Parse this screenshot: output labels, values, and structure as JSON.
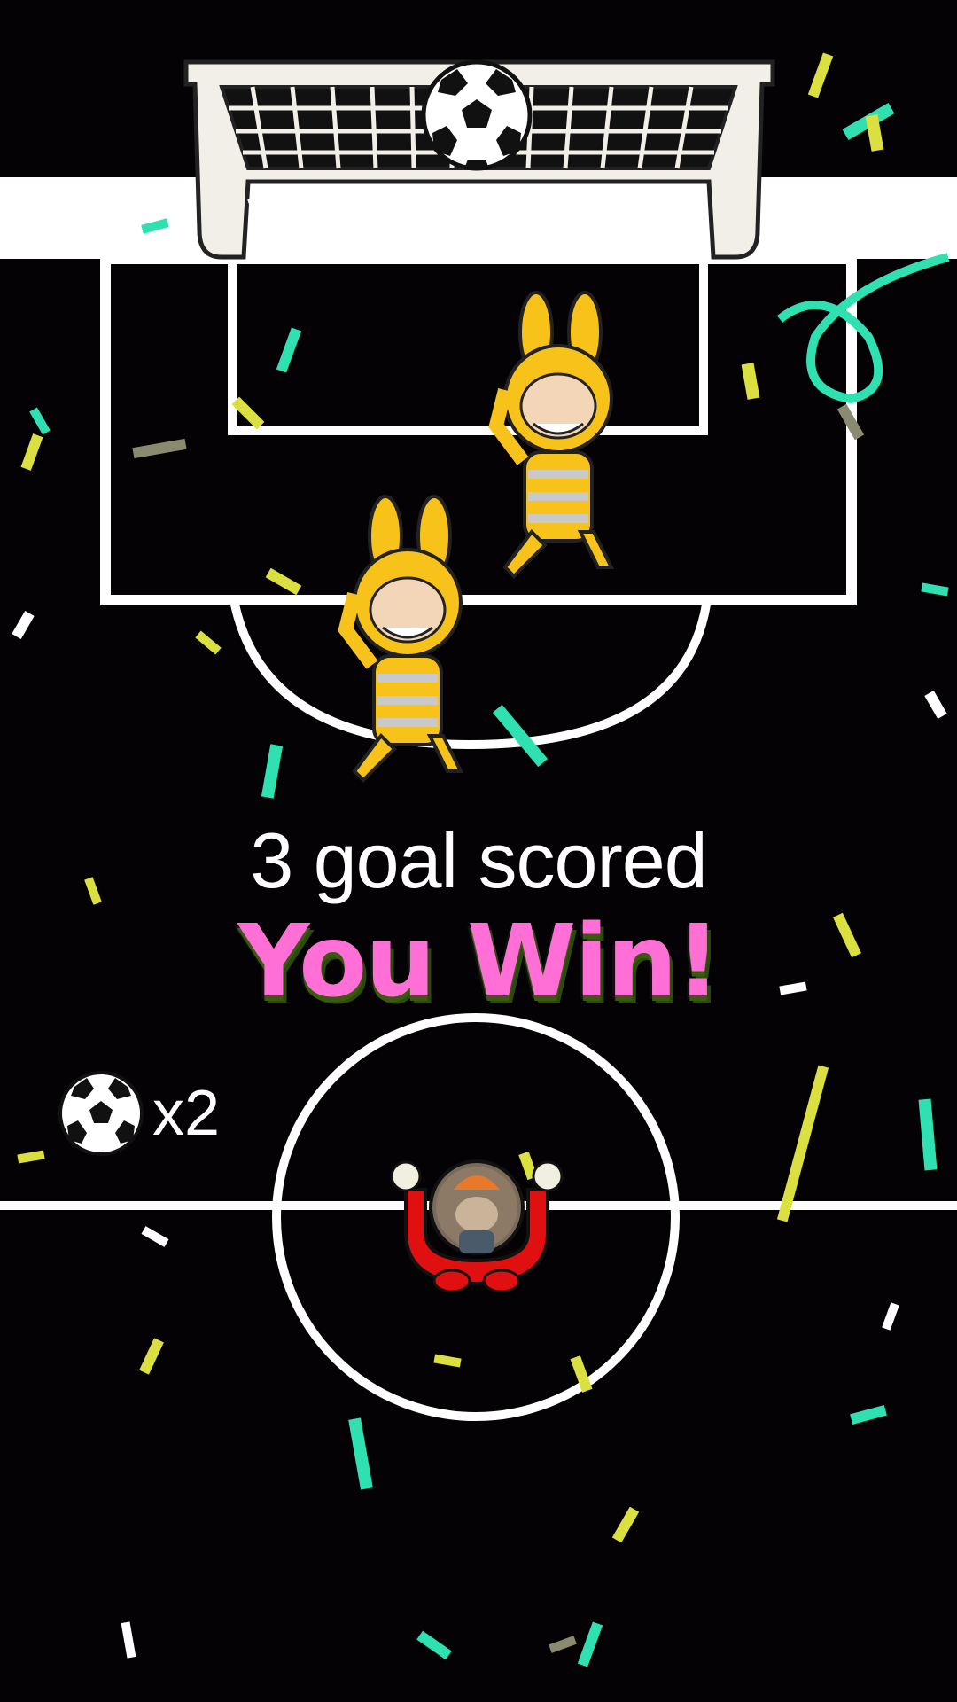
{
  "score": {
    "text": "3 goal scored"
  },
  "result": {
    "text": "You Win!"
  },
  "balls_remaining": {
    "label": "x2",
    "icon": "soccer-ball-icon"
  },
  "colors": {
    "background": "#050205",
    "field_lines": "#ffffff",
    "win_text": "#ff6fd6",
    "player_red": "#e01010",
    "mascot_yellow": "#f7c21a",
    "confetti": [
      "#2fe0b0",
      "#d9e040",
      "#ffffff",
      "#8a8a70"
    ]
  },
  "icons": {
    "goal": "goal-net-icon",
    "ball": "soccer-ball-icon",
    "defender": "bunny-mascot-icon",
    "player": "player-paddle-icon"
  }
}
